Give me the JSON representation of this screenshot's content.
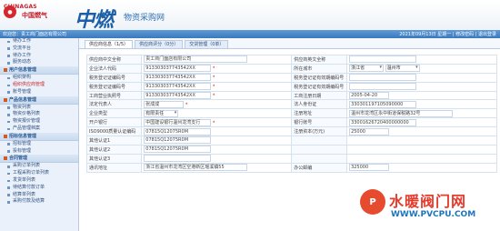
{
  "brand": {
    "en": "CHINAGAS",
    "cn": "中国燃气",
    "big": "中燃",
    "sub": "物资采购网"
  },
  "topbar": {
    "welcome": "欢迎您：贵工商门面店有限公司",
    "userlinks": "2021年09月13日 星期一 | 修改密码 | 退出登录"
  },
  "sidebar": {
    "sections": [
      {
        "title": "",
        "items": [
          "待办工作",
          "交流平台",
          "待办工作",
          "服务动态"
        ]
      },
      {
        "title": "用户信息管理",
        "items": [
          "组织架构",
          "组织供应商管理",
          "账号管理"
        ]
      },
      {
        "title": "产品信息管理",
        "items": [
          "物资列表",
          "物资价格列表",
          "物资报价管理",
          "产品管理档案"
        ]
      },
      {
        "title": "招标信息管理",
        "items": [
          "招标管理",
          "投标管理"
        ]
      },
      {
        "title": "合同管理",
        "items": [
          "采购订单列表",
          "工程采购订单列表",
          "发货单列表",
          "待结算付款订单",
          "结算单列表",
          "采购付款及结算"
        ]
      }
    ]
  },
  "tabs": [
    "供应商信息（1/5）",
    "供应商评分（0分）",
    "交货管理（0单）"
  ],
  "form": {
    "rows": [
      {
        "l1": "供应商中文全称",
        "v1": "贵工商门面店有限公司",
        "l2": "供应商英文全称",
        "v2": ""
      },
      {
        "l1": "企业法人代码",
        "v1": "913303037743542XX",
        "l2": "所在城市",
        "v2a": "浙江省",
        "v2b": "温州市"
      },
      {
        "l1": "税务登记证编码号",
        "v1": "913303037743542XX",
        "l2": "税务登记证有效期编码号",
        "v2": ""
      },
      {
        "l1": "税务登记证编码号",
        "v1": "913303037743542XX",
        "l2": "税务登记证有效期编码号",
        "v2": ""
      },
      {
        "l1": "工商营业执照号",
        "v1": "913303037743542XX",
        "l2": "工商注册日期",
        "v2": "2005-04-20"
      },
      {
        "l1": "法定代表人",
        "v1": "张成成",
        "l2": "法人身份证",
        "v2": "330301197105090000"
      },
      {
        "l1": "企业类型",
        "v1": "有限责任",
        "l2": "注册地址",
        "v2": "温州市龙湾区永中街道保税路32号"
      },
      {
        "l1": "开户银行",
        "v1": "中国建设银行温州龙湾支行",
        "l2": "银行账号",
        "v2": "33001626720400000000"
      },
      {
        "l1": "ISO9000质量认证编码",
        "v1": "07815Q12075R0M",
        "l2": "注册资本(万元)",
        "v2": "25000"
      },
      {
        "l1": "其他认证1",
        "v1": "07815Q12075R0M",
        "l2": "",
        "v2": ""
      },
      {
        "l1": "其他认证2",
        "v1": "07815Q12075R0M",
        "l2": "",
        "v2": ""
      },
      {
        "l1": "其他认证3",
        "v1": "",
        "l2": "",
        "v2": ""
      },
      {
        "l1": "通讯地址",
        "v1": "浙江省温州市龙湾区空港新区瑶溪镇55",
        "l2": "办公邮编",
        "v2": "325000"
      }
    ]
  },
  "watermark": {
    "text": "水暖阀门网",
    "url": "WWW.PVCPU.COM"
  }
}
